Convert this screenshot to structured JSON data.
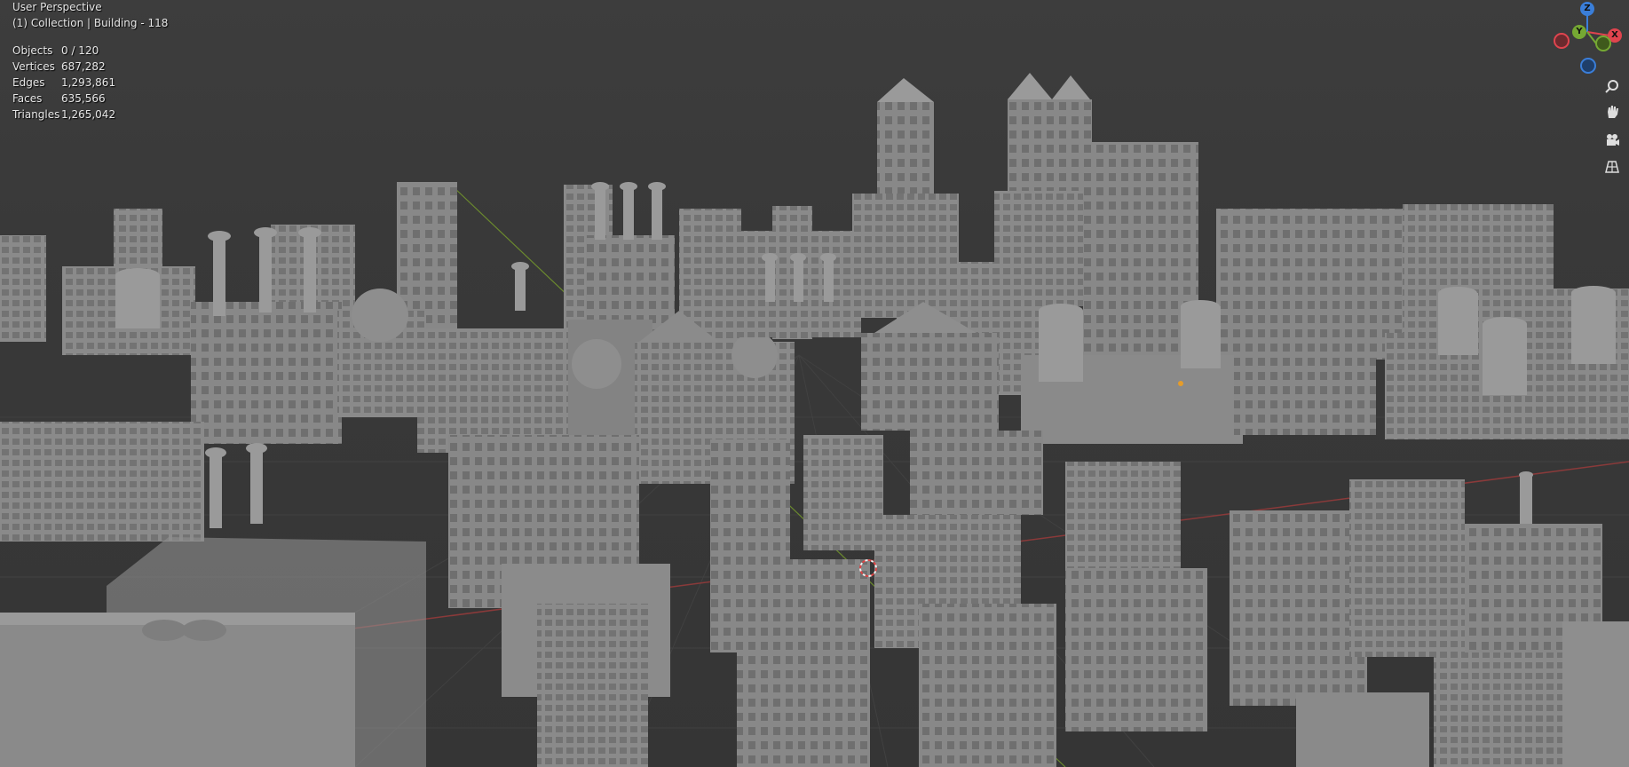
{
  "viewport": {
    "view_name": "User Perspective",
    "collection_label": "(1) Collection | Building - 118"
  },
  "stats": [
    {
      "label": "Objects",
      "value": "0 / 120"
    },
    {
      "label": "Vertices",
      "value": "687,282"
    },
    {
      "label": "Edges",
      "value": "1,293,861"
    },
    {
      "label": "Faces",
      "value": "635,566"
    },
    {
      "label": "Triangles",
      "value": "1,265,042"
    }
  ],
  "gizmo": {
    "z_label": "Z",
    "y_label": "Y",
    "x_label": "X",
    "colors": {
      "x": "#e0444e",
      "y": "#75a833",
      "z": "#3a7ed9"
    }
  },
  "nav_controls": [
    {
      "name": "zoom-icon"
    },
    {
      "name": "pan-hand-icon"
    },
    {
      "name": "camera-icon"
    },
    {
      "name": "grid-ortho-icon"
    }
  ],
  "colors": {
    "background": "#393939",
    "grid_x_axis": "#8a3a3a",
    "grid_y_axis": "#6b8a2e",
    "building": "#8c8c8c"
  }
}
